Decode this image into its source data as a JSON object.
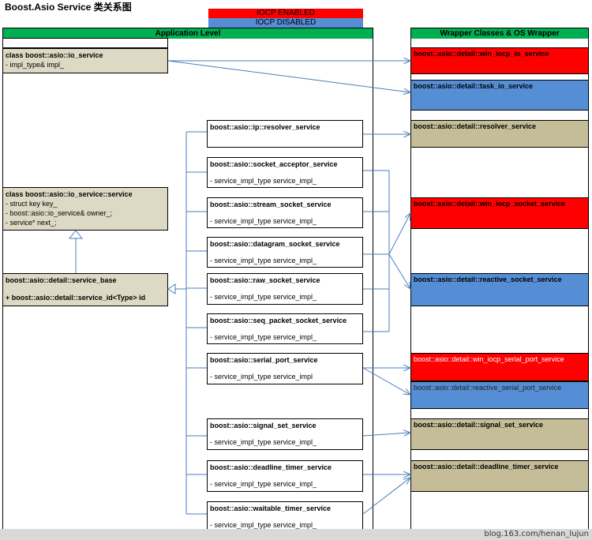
{
  "title": "Boost.Asio Service  类关系图",
  "legend": {
    "enabled": "IOCP ENABLED",
    "disabled": "IOCP DISABLED"
  },
  "left_panel": {
    "header": "Application Level"
  },
  "right_panel": {
    "header": "Wrapper Classes & OS Wrapper"
  },
  "io_service": {
    "name": "class boost::asio::io_service",
    "member": "- impl_type& impl_"
  },
  "io_service_service": {
    "name": "class boost::asio::io_service::service",
    "members": [
      "- struct key key_",
      "- boost::asio::io_service& owner_;",
      "- service* next_;"
    ]
  },
  "service_base": {
    "name": "boost::asio::detail::service_base",
    "member": "+ boost::asio::detail::service_id<Type> id"
  },
  "services": [
    {
      "name": "boost::asio::ip::resolver_service",
      "member": ""
    },
    {
      "name": "boost::asio::socket_acceptor_service",
      "member": "- service_impl_type service_impl_"
    },
    {
      "name": "boost::asio::stream_socket_service",
      "member": "- service_impl_type service_impl_"
    },
    {
      "name": "boost::asio::datagram_socket_service",
      "member": "- service_impl_type service_impl_"
    },
    {
      "name": "boost::asio::raw_socket_service",
      "member": "- service_impl_type service_impl_"
    },
    {
      "name": "boost::asio::seq_packet_socket_service",
      "member": "- service_impl_type service_impl_"
    },
    {
      "name": "boost::asio::serial_port_service",
      "member": "- service_impl_type service_impl"
    },
    {
      "name": "boost::asio::signal_set_service",
      "member": "- service_impl_type service_impl_"
    },
    {
      "name": "boost::asio::deadline_timer_service",
      "member": "- service_impl_type service_impl_"
    },
    {
      "name": "boost::asio::waitable_timer_service",
      "member": "- service_impl_type service_impl_"
    }
  ],
  "wrappers": [
    {
      "name": "boost::asio::detail::win_iocp_io_service",
      "color": "#ff0000"
    },
    {
      "name": "boost::asio::detail::task_io_service",
      "color": "#558ed5"
    },
    {
      "name": "boost::asio::detail::resolver_service",
      "color": "#c4bd97"
    },
    {
      "name": "boost::asio::detail::win_iocp_socket_service",
      "color": "#ff0000"
    },
    {
      "name": "boost::asio::detail::reactive_socket_service",
      "color": "#558ed5"
    },
    {
      "name": "boost::asio::detail::win_iocp_serial_port_service",
      "color": "#ff0000"
    },
    {
      "name": "boost::asio::detail::reactive_serial_port_service",
      "color": "#558ed5"
    },
    {
      "name": "boost::asio::detail::signal_set_service",
      "color": "#c4bd97"
    },
    {
      "name": "boost::asio::detail::deadline_timer_service",
      "color": "#c4bd97"
    }
  ],
  "watermark": "blog.163.com/henan_lujun"
}
